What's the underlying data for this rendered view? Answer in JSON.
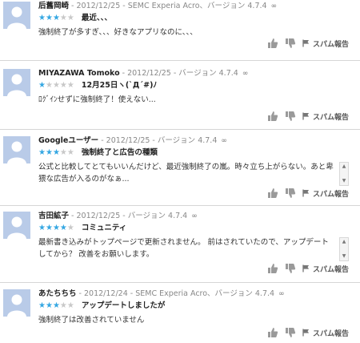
{
  "reviews": [
    {
      "author": "后舊岡崎",
      "meta": "- 2012/12/25 - SEMC Experia Acro、バージョン 4.7.4",
      "rating": 3,
      "title": "最近、、、",
      "body": "強制終了が多すぎ、、、好きなアプリなのに、、、",
      "has_scroll": false
    },
    {
      "author": "MIYAZAWA Tomoko",
      "meta": "- 2012/12/25 - バージョン 4.7.4",
      "rating": 1,
      "title": "12月25日ヽ(`Д´#)ﾉ",
      "body": "ﾛｸﾞｲﾝせずに強制終了！使えない...",
      "has_scroll": false
    },
    {
      "author": "Googleユーザー",
      "meta": "- 2012/12/25 - バージョン 4.7.4",
      "rating": 3,
      "title": "強制終了と広告の種類",
      "body": "公式と比較してとてもいいんだけど、最近強制終了の嵐。時々立ち上がらない。あと卑猥な広告が入るのがなぁ...",
      "has_scroll": true
    },
    {
      "author": "吉田絋子",
      "meta": "- 2012/12/25 - バージョン 4.7.4",
      "rating": 4,
      "title": "コミュニティ",
      "body": "最新書き込みがトップページで更新されません。 前はされていたので、アップデートしてから？ 改善をお願いします。",
      "has_scroll": true
    },
    {
      "author": "あたちちち",
      "meta": "- 2012/12/24 - SEMC Experia Acro、バージョン 4.7.4",
      "rating": 3,
      "title": "アップデートしましたが",
      "body": "強制終了は改善されていません",
      "has_scroll": false
    }
  ],
  "labels": {
    "spam": "スパム報告",
    "max_rating": 5
  },
  "icons": {
    "avatar": "default-user-icon",
    "device_badge": "link-icon",
    "like": "thumbs-up-icon",
    "dislike": "thumbs-down-icon",
    "spam": "flag-icon",
    "scroll_up": "scroll-up-arrow-icon",
    "scroll_down": "scroll-down-arrow-icon"
  },
  "colors": {
    "star_on": "#35a7e2",
    "star_off": "#c8c8c8",
    "avatar_bg": "#b9cbe8"
  }
}
